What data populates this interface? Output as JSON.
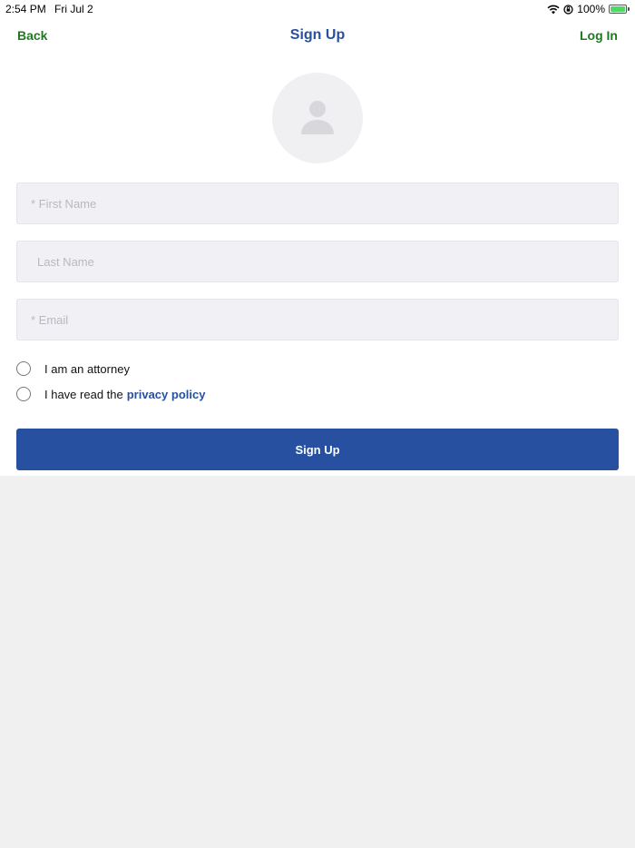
{
  "status_bar": {
    "time": "2:54 PM",
    "date": "Fri Jul 2",
    "battery_text": "100%",
    "icons": [
      "wifi-icon",
      "lock-rotation-icon",
      "battery-charging-icon"
    ]
  },
  "nav": {
    "back_label": "Back",
    "title": "Sign Up",
    "login_label": "Log In"
  },
  "avatar": {
    "icon": "person-icon"
  },
  "form": {
    "first_name_placeholder": "* First Name",
    "last_name_placeholder": "Last Name",
    "email_placeholder": "* Email",
    "attorney_label": "I am an attorney",
    "privacy_prefix": "I have read the",
    "privacy_link": "privacy policy",
    "attorney_checked": false,
    "privacy_checked": false
  },
  "signup_button": "Sign Up",
  "colors": {
    "accent_blue": "#27509e",
    "nav_green": "#1f7a1f",
    "background_gray": "#f0f0f1"
  }
}
